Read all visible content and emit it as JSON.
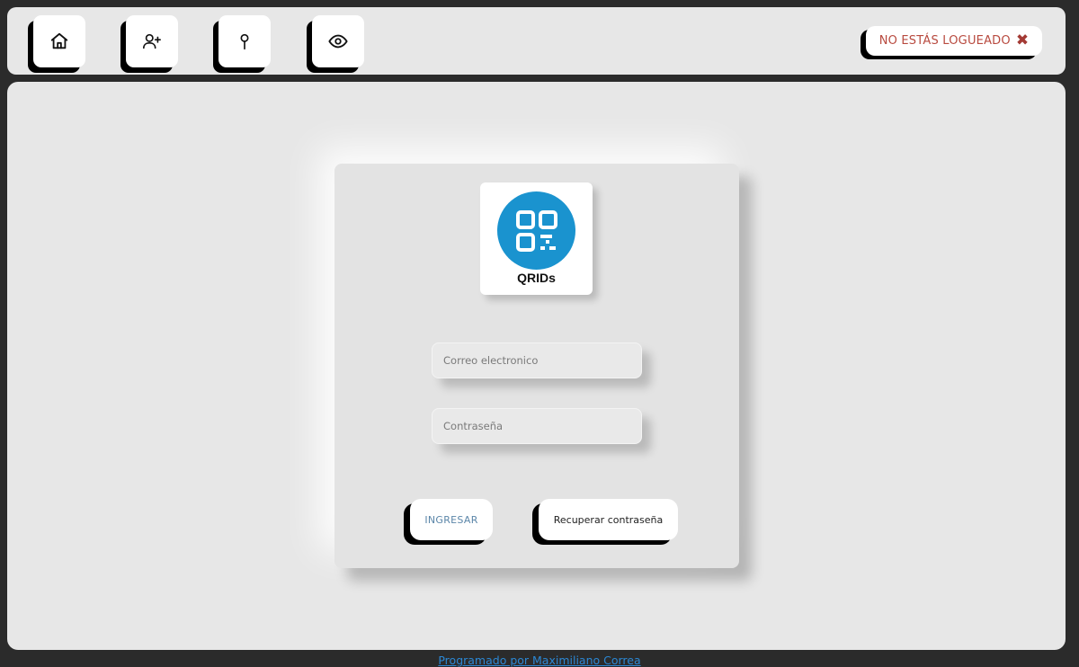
{
  "nav": {
    "items": [
      {
        "icon": "home-icon",
        "label": "home"
      },
      {
        "icon": "user-plus-icon",
        "label": "register"
      },
      {
        "icon": "map-pin-icon",
        "label": "location"
      },
      {
        "icon": "eye-icon",
        "label": "view"
      }
    ]
  },
  "status": {
    "text": "NO ESTÁS LOGUEADO",
    "icon": "close-x-icon",
    "text_color": "#b84a3f"
  },
  "logo": {
    "text": "QRIDs",
    "icon": "qr-code-icon",
    "circle_color": "#1a93cf"
  },
  "form": {
    "email_placeholder": "Correo electronico",
    "email_value": "",
    "password_placeholder": "Contraseña",
    "password_value": "",
    "login_label": "INGRESAR",
    "recover_label": "Recuperar contraseña"
  },
  "footer": {
    "credit": "Programado por Maximiliano Correa",
    "link_color": "#2b87d4"
  }
}
